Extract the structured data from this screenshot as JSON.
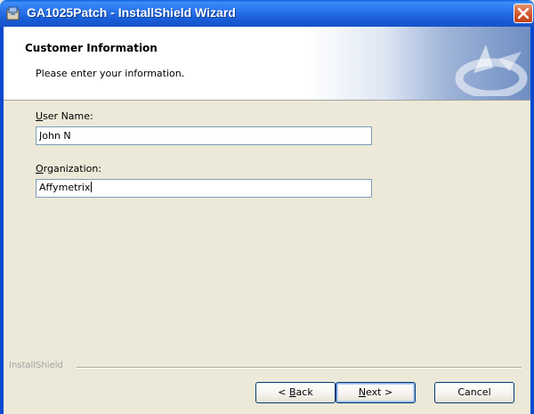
{
  "window": {
    "title": "GA1025Patch - InstallShield Wizard"
  },
  "banner": {
    "title": "Customer Information",
    "subtitle": "Please enter your information."
  },
  "form": {
    "user_name_label_accel": "U",
    "user_name_label_rest": "ser Name:",
    "user_name_value": "John N",
    "organization_label_accel": "O",
    "organization_label_rest": "rganization:",
    "organization_value": "Affymetrix"
  },
  "footer": {
    "brand_label": "InstallShield",
    "back_accel": "B",
    "back_prefix": "< ",
    "back_rest": "ack",
    "next_accel": "N",
    "next_rest": "ext >",
    "cancel_label": "Cancel"
  },
  "icons": {
    "app": "installer-icon",
    "close": "close-icon",
    "banner": "installshield-logo-icon"
  }
}
